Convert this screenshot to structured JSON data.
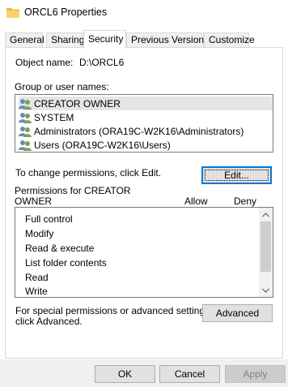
{
  "window": {
    "title": "ORCL6 Properties"
  },
  "tabs": [
    {
      "label": "General"
    },
    {
      "label": "Sharing"
    },
    {
      "label": "Security",
      "active": true
    },
    {
      "label": "Previous Versions"
    },
    {
      "label": "Customize"
    }
  ],
  "security": {
    "object_name_label": "Object name:",
    "object_name_value": "D:\\ORCL6",
    "groups_label": "Group or user names:",
    "groups": [
      {
        "name": "CREATOR OWNER",
        "icon": "user-group-icon",
        "selected": true
      },
      {
        "name": "SYSTEM",
        "icon": "user-group-icon"
      },
      {
        "name": "Administrators (ORA19C-W2K16\\Administrators)",
        "icon": "user-group-icon"
      },
      {
        "name": "Users (ORA19C-W2K16\\Users)",
        "icon": "user-group-icon"
      }
    ],
    "change_text": "To change permissions, click Edit.",
    "edit_button": "Edit...",
    "permissions_for_line1": "Permissions for CREATOR",
    "permissions_for_line2": "OWNER",
    "allow_header": "Allow",
    "deny_header": "Deny",
    "permissions": [
      "Full control",
      "Modify",
      "Read & execute",
      "List folder contents",
      "Read",
      "Write"
    ],
    "special_text_line1": "For special permissions or advanced settings,",
    "special_text_line2": "click Advanced.",
    "advanced_button": "Advanced"
  },
  "footer": {
    "ok": "OK",
    "cancel": "Cancel",
    "apply": "Apply"
  },
  "colors": {
    "focus_border": "#0078d7",
    "selected_row": "#e5e5e5",
    "folder_yellow": "#f0c543"
  }
}
